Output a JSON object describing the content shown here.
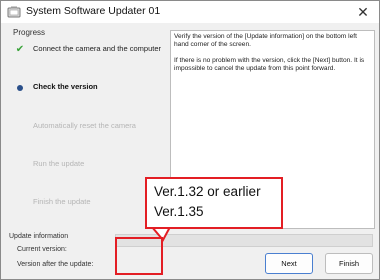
{
  "window": {
    "title": "System Software Updater 01",
    "close_symbol": "✕",
    "accent_color": "#e31e24"
  },
  "progress": {
    "label": "Progress",
    "steps": [
      {
        "label": "Connect the camera and the computer",
        "state": "done",
        "icon": "check-icon"
      },
      {
        "label": "Check the version",
        "state": "current",
        "icon": "current-step-dot-icon"
      },
      {
        "label": "Automatically reset the camera",
        "state": "pending",
        "icon": ""
      },
      {
        "label": "Run the update",
        "state": "pending",
        "icon": ""
      },
      {
        "label": "Finish the update",
        "state": "pending",
        "icon": ""
      }
    ]
  },
  "info": {
    "paragraph1": "Verify the version of the [Update information] on the bottom left hand corner of the screen.",
    "paragraph2": "If there is no problem with the version, click the [Next] button. It is impossible to cancel the update from this point forward."
  },
  "update_info": {
    "label": "Update information",
    "current_version_label": "Current version:",
    "after_version_label": "Version after the update:"
  },
  "callout": {
    "line1": "Ver.1.32 or earlier",
    "line2": "Ver.1.35"
  },
  "buttons": {
    "next": "Next",
    "finish": "Finish"
  }
}
